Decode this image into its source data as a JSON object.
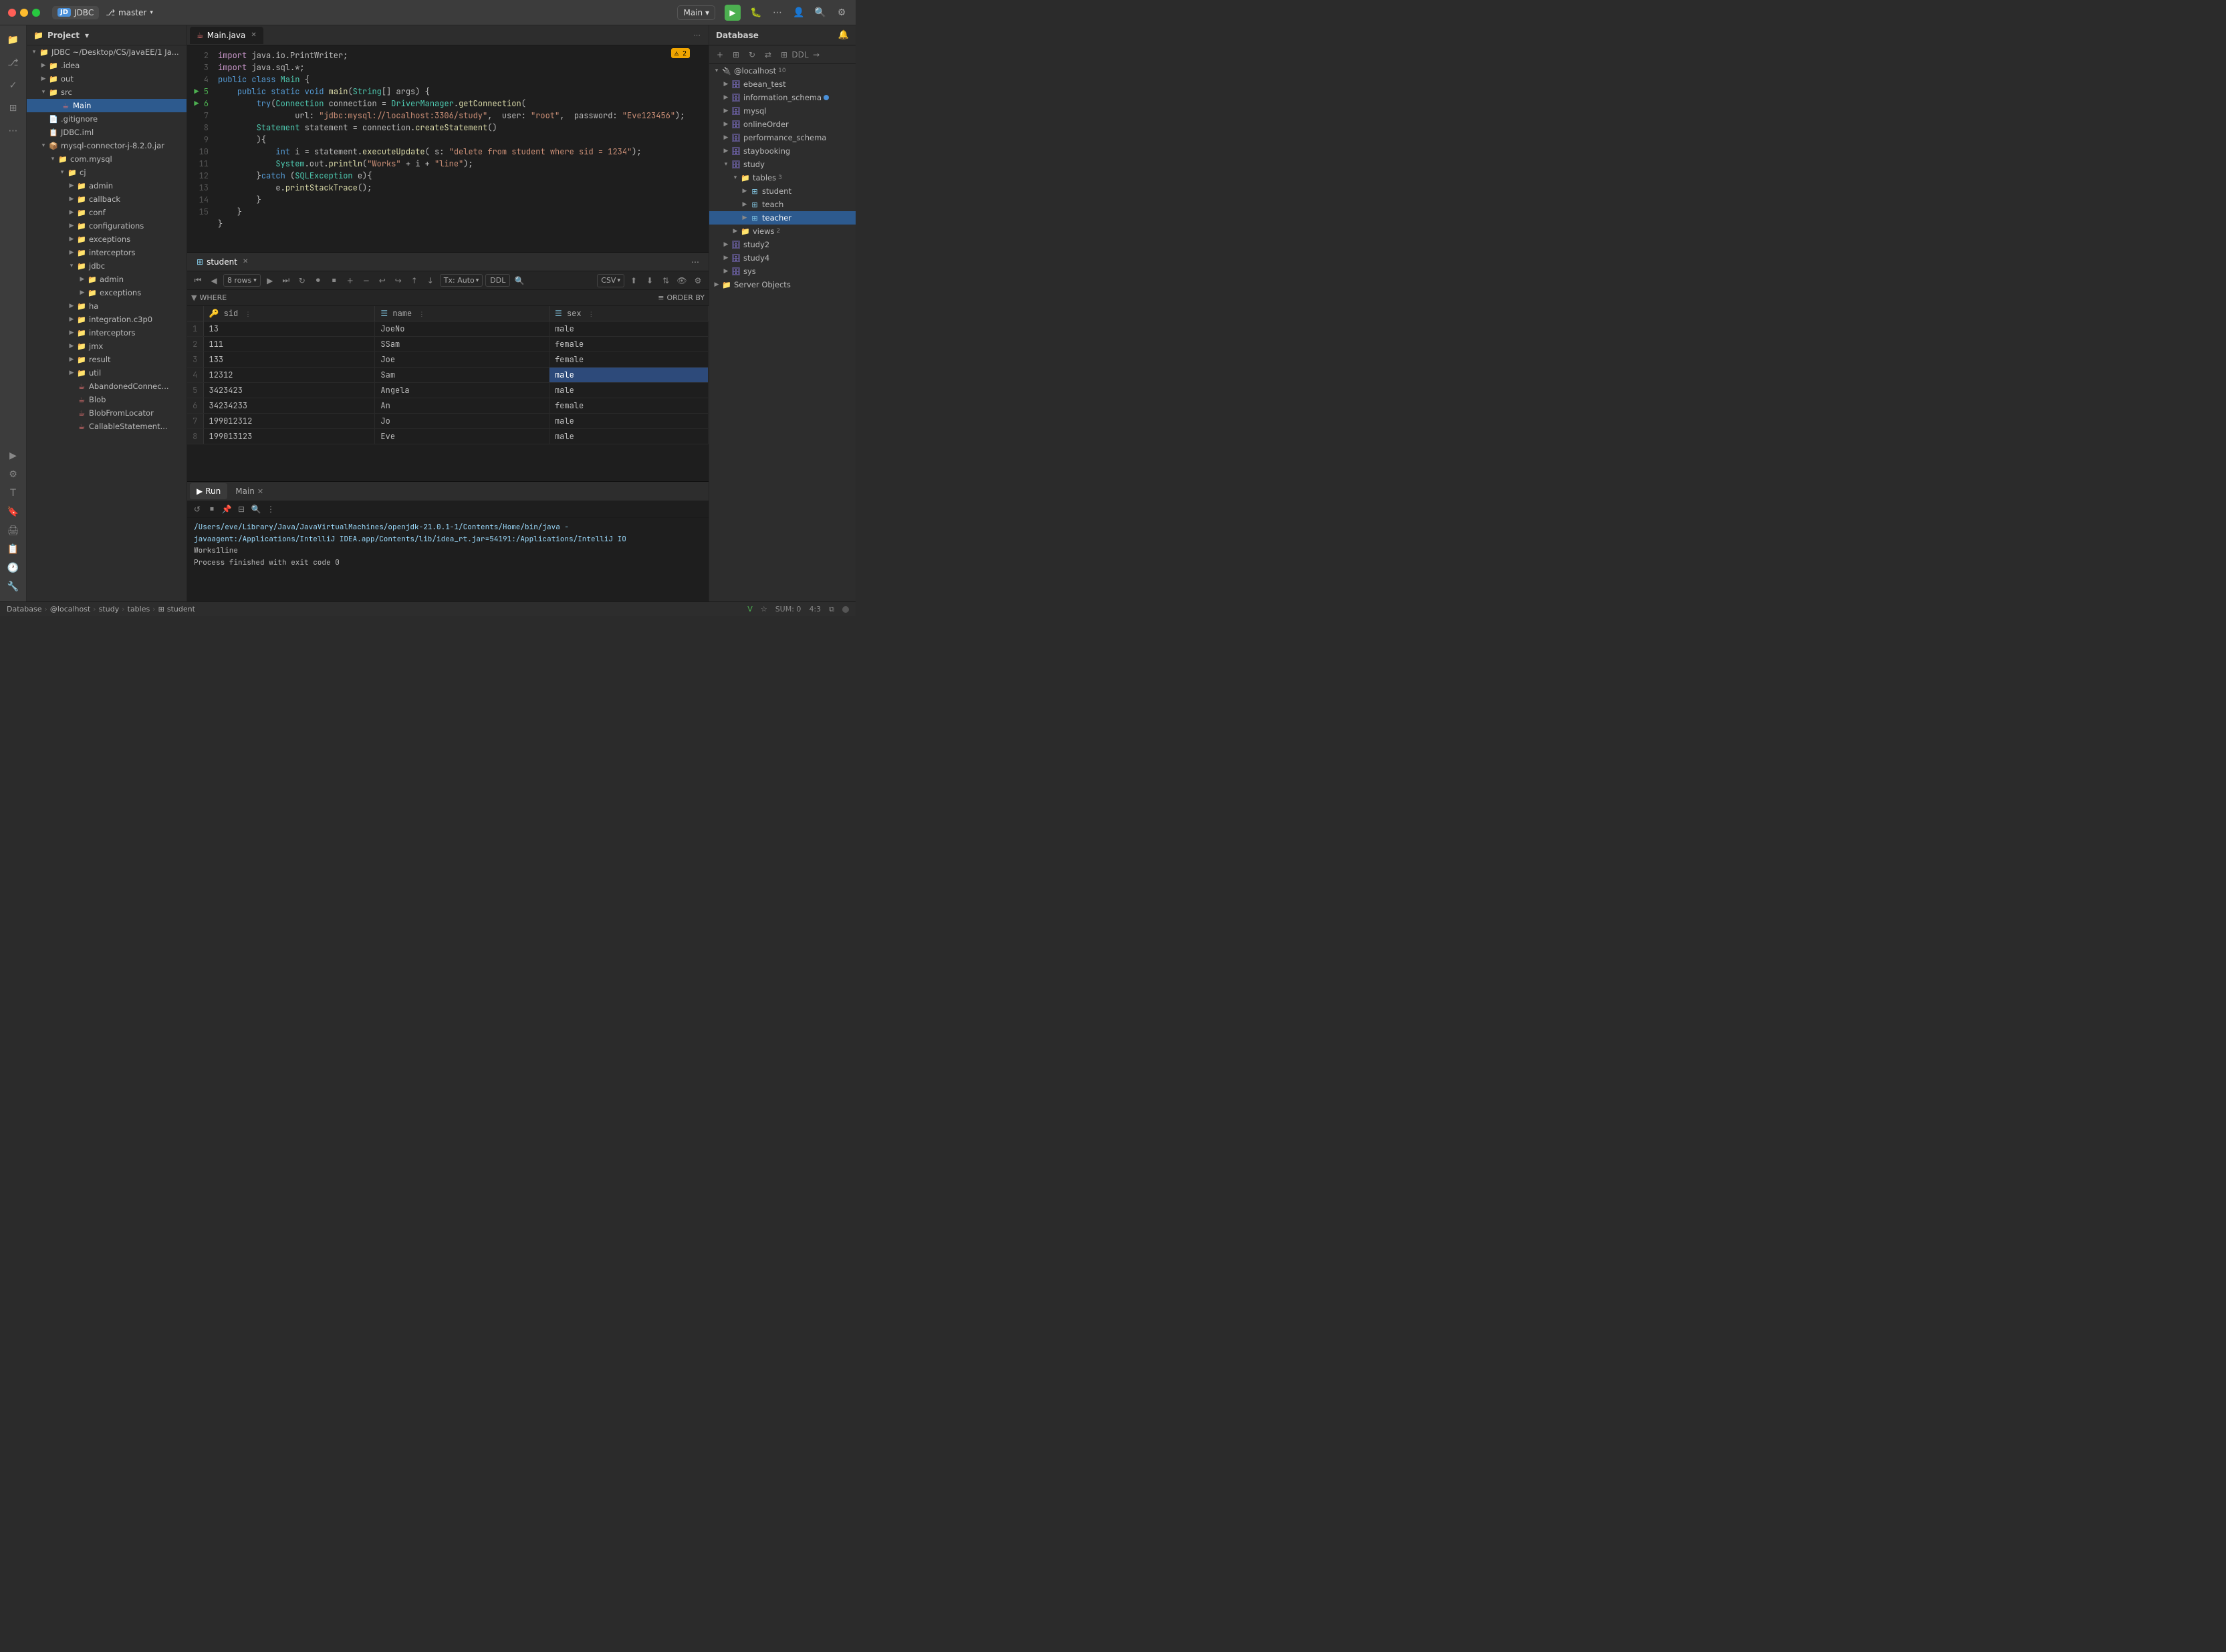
{
  "titlebar": {
    "project_icon": "JD",
    "project_name": "JDBC",
    "branch_icon": "⎇",
    "branch_name": "master",
    "main_label": "Main",
    "run_icon": "▶",
    "settings_icon": "⚙"
  },
  "sidebar": {
    "header": "Project",
    "tree": [
      {
        "id": "jdbc-root",
        "label": "JDBC ~/Desktop/CS/JavaEE/1 Ja...",
        "level": 0,
        "type": "folder",
        "open": true
      },
      {
        "id": "idea",
        "label": ".idea",
        "level": 1,
        "type": "folder",
        "open": false
      },
      {
        "id": "out",
        "label": "out",
        "level": 1,
        "type": "folder",
        "open": false
      },
      {
        "id": "src",
        "label": "src",
        "level": 1,
        "type": "folder",
        "open": true
      },
      {
        "id": "main",
        "label": "Main",
        "level": 2,
        "type": "java",
        "open": false,
        "selected": true
      },
      {
        "id": "gitignore",
        "label": ".gitignore",
        "level": 1,
        "type": "file"
      },
      {
        "id": "jdbciml",
        "label": "JDBC.iml",
        "level": 1,
        "type": "xml"
      },
      {
        "id": "mysql-connector",
        "label": "mysql-connector-j-8.2.0.jar",
        "level": 1,
        "type": "jar",
        "open": true
      },
      {
        "id": "com-mysql",
        "label": "com.mysql",
        "level": 2,
        "type": "folder",
        "open": true
      },
      {
        "id": "cj",
        "label": "cj",
        "level": 3,
        "type": "folder",
        "open": true
      },
      {
        "id": "admin",
        "label": "admin",
        "level": 4,
        "type": "folder"
      },
      {
        "id": "callback",
        "label": "callback",
        "level": 4,
        "type": "folder"
      },
      {
        "id": "conf",
        "label": "conf",
        "level": 4,
        "type": "folder"
      },
      {
        "id": "configurations",
        "label": "configurations",
        "level": 4,
        "type": "folder"
      },
      {
        "id": "exceptions",
        "label": "exceptions",
        "level": 4,
        "type": "folder"
      },
      {
        "id": "interceptors",
        "label": "interceptors",
        "level": 4,
        "type": "folder"
      },
      {
        "id": "jdbc",
        "label": "jdbc",
        "level": 4,
        "type": "folder",
        "open": true
      },
      {
        "id": "jdbc-admin",
        "label": "admin",
        "level": 5,
        "type": "folder"
      },
      {
        "id": "jdbc-exceptions",
        "label": "exceptions",
        "level": 5,
        "type": "folder"
      },
      {
        "id": "ha",
        "label": "ha",
        "level": 4,
        "type": "folder"
      },
      {
        "id": "integration-c3p0",
        "label": "integration.c3p0",
        "level": 4,
        "type": "folder"
      },
      {
        "id": "interceptors2",
        "label": "interceptors",
        "level": 4,
        "type": "folder"
      },
      {
        "id": "jmx",
        "label": "jmx",
        "level": 4,
        "type": "folder"
      },
      {
        "id": "result",
        "label": "result",
        "level": 4,
        "type": "folder"
      },
      {
        "id": "util",
        "label": "util",
        "level": 4,
        "type": "folder"
      },
      {
        "id": "abandoned",
        "label": "AbandonedConnec...",
        "level": 4,
        "type": "java"
      },
      {
        "id": "blob",
        "label": "Blob",
        "level": 4,
        "type": "java"
      },
      {
        "id": "blobfromlocator",
        "label": "BlobFromLocator",
        "level": 4,
        "type": "java"
      },
      {
        "id": "callablestatement",
        "label": "CallableStatement...",
        "level": 4,
        "type": "java"
      }
    ]
  },
  "editor": {
    "tab_name": "Main.java",
    "warning_count": "⚠ 2",
    "lines": [
      {
        "num": 2,
        "code": "import java.io.PrintWriter;",
        "tokens": [
          {
            "t": "kw",
            "v": "import"
          },
          {
            "t": "",
            "v": " java.io.PrintWriter;"
          }
        ]
      },
      {
        "num": 3,
        "code": "import java.sql.*;",
        "tokens": [
          {
            "t": "kw",
            "v": "import"
          },
          {
            "t": "",
            "v": " java.sql.*;"
          }
        ]
      },
      {
        "num": 4,
        "code": "public class Main {"
      },
      {
        "num": 5,
        "code": "    try(Connection connection = DriverManager.getConnection("
      },
      {
        "num": 6,
        "code": "        url: \"jdbc:mysql://localhost:3306/study\",  user: \"root\",  password: \"Eve123456\");"
      },
      {
        "num": 7,
        "code": "    Statement statement = connection.createStatement()"
      },
      {
        "num": 8,
        "code": "    ){"
      },
      {
        "num": 9,
        "code": "        int i = statement.executeUpdate( s: \"delete from student where sid = 1234\");"
      },
      {
        "num": 10,
        "code": "        System.out.println(\"Works\" + i + \"line\");"
      },
      {
        "num": 11,
        "code": "    }catch (SQLException e){"
      },
      {
        "num": 12,
        "code": "        e.printStackTrace();"
      },
      {
        "num": 13,
        "code": "    }"
      },
      {
        "num": 14,
        "code": "  }"
      },
      {
        "num": 15,
        "code": "}"
      }
    ]
  },
  "data_table": {
    "tab_name": "student",
    "rows_label": "8 rows",
    "tx_label": "Tx: Auto",
    "ddl_label": "DDL",
    "csv_label": "CSV",
    "filter_label": "WHERE",
    "order_label": "ORDER BY",
    "columns": [
      {
        "name": "sid",
        "icon": "🔑"
      },
      {
        "name": "name",
        "icon": "☰"
      },
      {
        "name": "sex",
        "icon": "☰"
      }
    ],
    "rows": [
      {
        "num": "1",
        "sid": "13",
        "name": "JoeNo",
        "sex": "male"
      },
      {
        "num": "2",
        "sid": "111",
        "name": "SSam",
        "sex": "female"
      },
      {
        "num": "3",
        "sid": "133",
        "name": "Joe",
        "sex": "female"
      },
      {
        "num": "4",
        "sid": "12312",
        "name": "Sam",
        "sex": "male",
        "selected_col": "sex"
      },
      {
        "num": "5",
        "sid": "3423423",
        "name": "Angela",
        "sex": "male"
      },
      {
        "num": "6",
        "sid": "34234233",
        "name": "An",
        "sex": "female"
      },
      {
        "num": "7",
        "sid": "199012312",
        "name": "Jo",
        "sex": "male"
      },
      {
        "num": "8",
        "sid": "199013123",
        "name": "Eve",
        "sex": "male"
      }
    ]
  },
  "run_panel": {
    "tab_label": "Run",
    "main_tab_label": "Main",
    "console_line1": "/Users/eve/Library/Java/JavaVirtualMachines/openjdk-21.0.1-1/Contents/Home/bin/java -javaagent:/Applications/IntelliJ IDEA.app/Contents/lib/idea_rt.jar=54191:/Applications/IntelliJ IO",
    "console_line2": "Works1line",
    "console_line3": "",
    "console_line4": "Process finished with exit code 0"
  },
  "database": {
    "header": "Database",
    "items": [
      {
        "id": "localhost",
        "label": "@localhost",
        "type": "connection",
        "badge": "10",
        "level": 0,
        "open": true
      },
      {
        "id": "ebean_test",
        "label": "ebean_test",
        "type": "schema",
        "level": 1
      },
      {
        "id": "information_schema",
        "label": "information_schema",
        "type": "schema",
        "level": 1
      },
      {
        "id": "mysql",
        "label": "mysql",
        "type": "schema",
        "level": 1
      },
      {
        "id": "onlineorder",
        "label": "onlineOrder",
        "type": "schema",
        "level": 1
      },
      {
        "id": "performance_schema",
        "label": "performance_schema",
        "type": "schema",
        "level": 1
      },
      {
        "id": "staybooking",
        "label": "staybooking",
        "type": "schema",
        "level": 1
      },
      {
        "id": "study",
        "label": "study",
        "type": "schema",
        "level": 1,
        "open": true
      },
      {
        "id": "tables",
        "label": "tables",
        "type": "folder",
        "badge": "3",
        "level": 2,
        "open": true
      },
      {
        "id": "student",
        "label": "student",
        "type": "table",
        "level": 3
      },
      {
        "id": "teach",
        "label": "teach",
        "type": "table",
        "level": 3
      },
      {
        "id": "teacher",
        "label": "teacher",
        "type": "table",
        "level": 3,
        "selected": true
      },
      {
        "id": "views",
        "label": "views",
        "type": "folder",
        "badge": "2",
        "level": 2
      },
      {
        "id": "study2",
        "label": "study2",
        "type": "schema",
        "level": 1
      },
      {
        "id": "study4",
        "label": "study4",
        "type": "schema",
        "level": 1
      },
      {
        "id": "sys",
        "label": "sys",
        "type": "schema",
        "level": 1
      },
      {
        "id": "server-objects",
        "label": "Server Objects",
        "type": "folder",
        "level": 0
      }
    ]
  },
  "status_bar": {
    "breadcrumbs": [
      "Database",
      "@localhost",
      "study",
      "tables",
      "student"
    ],
    "sum": "SUM: 0",
    "position": "4:3"
  }
}
